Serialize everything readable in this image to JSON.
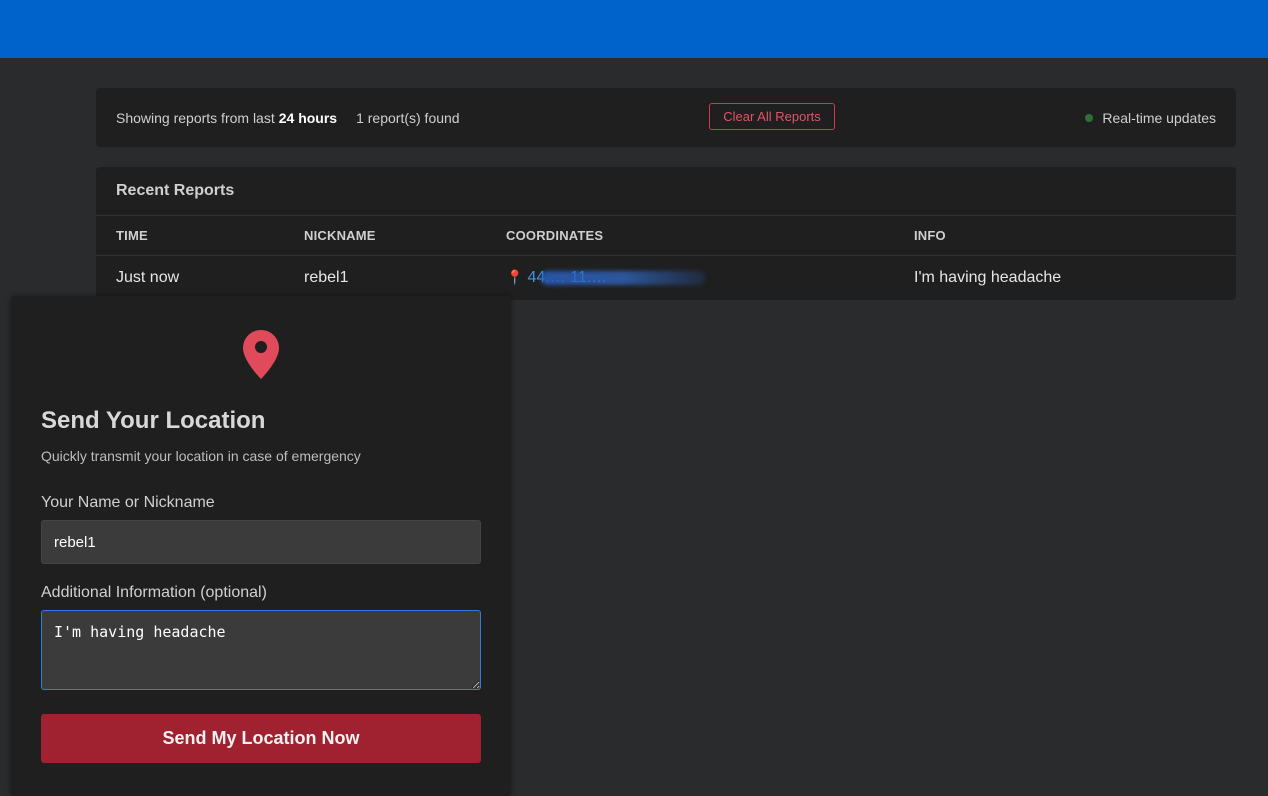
{
  "status": {
    "showing_prefix": "Showing reports from last",
    "time_window": "24 hours",
    "count_text": "1 report(s) found",
    "clear_button": "Clear All Reports",
    "realtime_label": "Real-time updates"
  },
  "reports": {
    "title": "Recent Reports",
    "columns": [
      "TIME",
      "NICKNAME",
      "COORDINATES",
      "INFO"
    ],
    "rows": [
      {
        "time": "Just now",
        "nickname": "rebel1",
        "coordinates": "44.… 11.…",
        "info": "I'm having headache"
      }
    ]
  },
  "send_form": {
    "icon": "map-pin-icon",
    "title": "Send Your Location",
    "subtitle": "Quickly transmit your location in case of emergency",
    "name_label": "Your Name or Nickname",
    "name_value": "rebel1",
    "info_label": "Additional Information (optional)",
    "info_value": "I'm having headache",
    "submit_label": "Send My Location Now"
  },
  "colors": {
    "header": "#0063cc",
    "accent_red": "#a0212f",
    "link_blue": "#4a8fe8",
    "live_dot": "#2f6f3a"
  }
}
